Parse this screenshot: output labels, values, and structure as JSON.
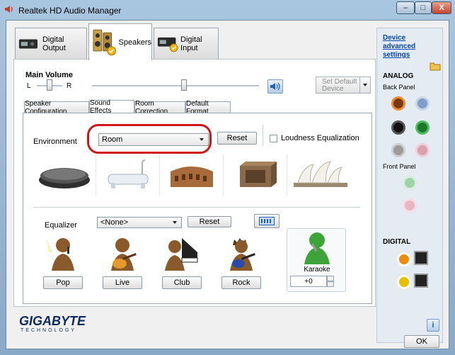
{
  "window": {
    "title": "Realtek HD Audio Manager",
    "min_symbol": "–",
    "max_symbol": "□",
    "close_symbol": "X"
  },
  "main_tabs": [
    {
      "label": "Digital Output"
    },
    {
      "label": "Speakers"
    },
    {
      "label": "Digital Input"
    }
  ],
  "volume": {
    "title": "Main Volume",
    "left_label": "L",
    "right_label": "R",
    "balance_level": 0.5,
    "volume_level": 0.55,
    "set_default_label": "Set Default\nDevice"
  },
  "sub_tabs": [
    {
      "label": "Speaker Configuration"
    },
    {
      "label": "Sound Effects"
    },
    {
      "label": "Room Correction"
    },
    {
      "label": "Default Format"
    }
  ],
  "environment": {
    "label": "Environment",
    "selected": "Room",
    "reset_label": "Reset",
    "loudness_label": "Loudness Equalization",
    "loudness_checked": false
  },
  "equalizer": {
    "label": "Equalizer",
    "selected": "<None>",
    "reset_label": "Reset",
    "presets": [
      {
        "label": "Pop"
      },
      {
        "label": "Live"
      },
      {
        "label": "Club"
      },
      {
        "label": "Rock"
      }
    ]
  },
  "karaoke": {
    "label": "Karaoke",
    "value": "+0"
  },
  "brand": {
    "name": "GIGABYTE",
    "tagline": "TECHNOLOGY"
  },
  "side": {
    "link_text": "Device advanced settings",
    "analog_label": "ANALOG",
    "back_panel_label": "Back Panel",
    "front_panel_label": "Front Panel",
    "digital_label": "DIGITAL"
  },
  "footer": {
    "info_label": "i",
    "ok_label": "OK"
  },
  "colors": {
    "highlight_red": "#d0161b",
    "link_blue": "#0645ad"
  }
}
